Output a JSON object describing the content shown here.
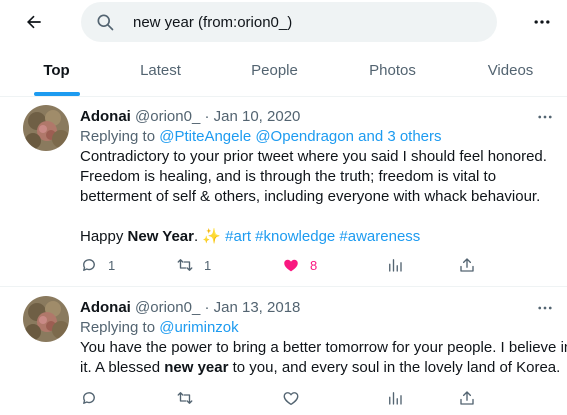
{
  "search": {
    "query": "new year (from:orion0_)"
  },
  "tabs": [
    {
      "label": "Top",
      "active": true
    },
    {
      "label": "Latest",
      "active": false
    },
    {
      "label": "People",
      "active": false
    },
    {
      "label": "Photos",
      "active": false
    },
    {
      "label": "Videos",
      "active": false
    }
  ],
  "colors": {
    "accent": "#1d9bf0",
    "like": "#f91880",
    "secondary_text": "#536471"
  },
  "tweets": [
    {
      "author": "Adonai",
      "handle": "@orion0_",
      "dot": "·",
      "date": "Jan 10, 2020",
      "replying_prefix": "Replying to",
      "replying_mentions": "@PtiteAngele @Opendragon and 3 others",
      "lines": [
        "Contradictory to your prior tweet where you said I should feel honored.",
        "Freedom is healing, and is through the truth; freedom is vital to",
        "betterment of self & others, including everyone with whack behaviour."
      ],
      "last_line": {
        "pre": "Happy ",
        "bold": "New Year",
        "post": ". ✨ ",
        "hashtags": "#art #knowledge #awareness"
      },
      "reply_count": "1",
      "retweet_count": "1",
      "like_count": "8",
      "liked": true
    },
    {
      "author": "Adonai",
      "handle": "@orion0_",
      "dot": "·",
      "date": "Jan 13, 2018",
      "replying_prefix": "Replying to",
      "replying_mentions": "@uriminzok",
      "line1": "You have the power to bring a better tomorrow for your people. I believe in",
      "line2": {
        "pre": "it. A blessed ",
        "bold": "new year",
        "post": " to you, and every soul in the lovely land of Korea."
      },
      "reply_count": "",
      "retweet_count": "",
      "like_count": "",
      "liked": false
    }
  ]
}
